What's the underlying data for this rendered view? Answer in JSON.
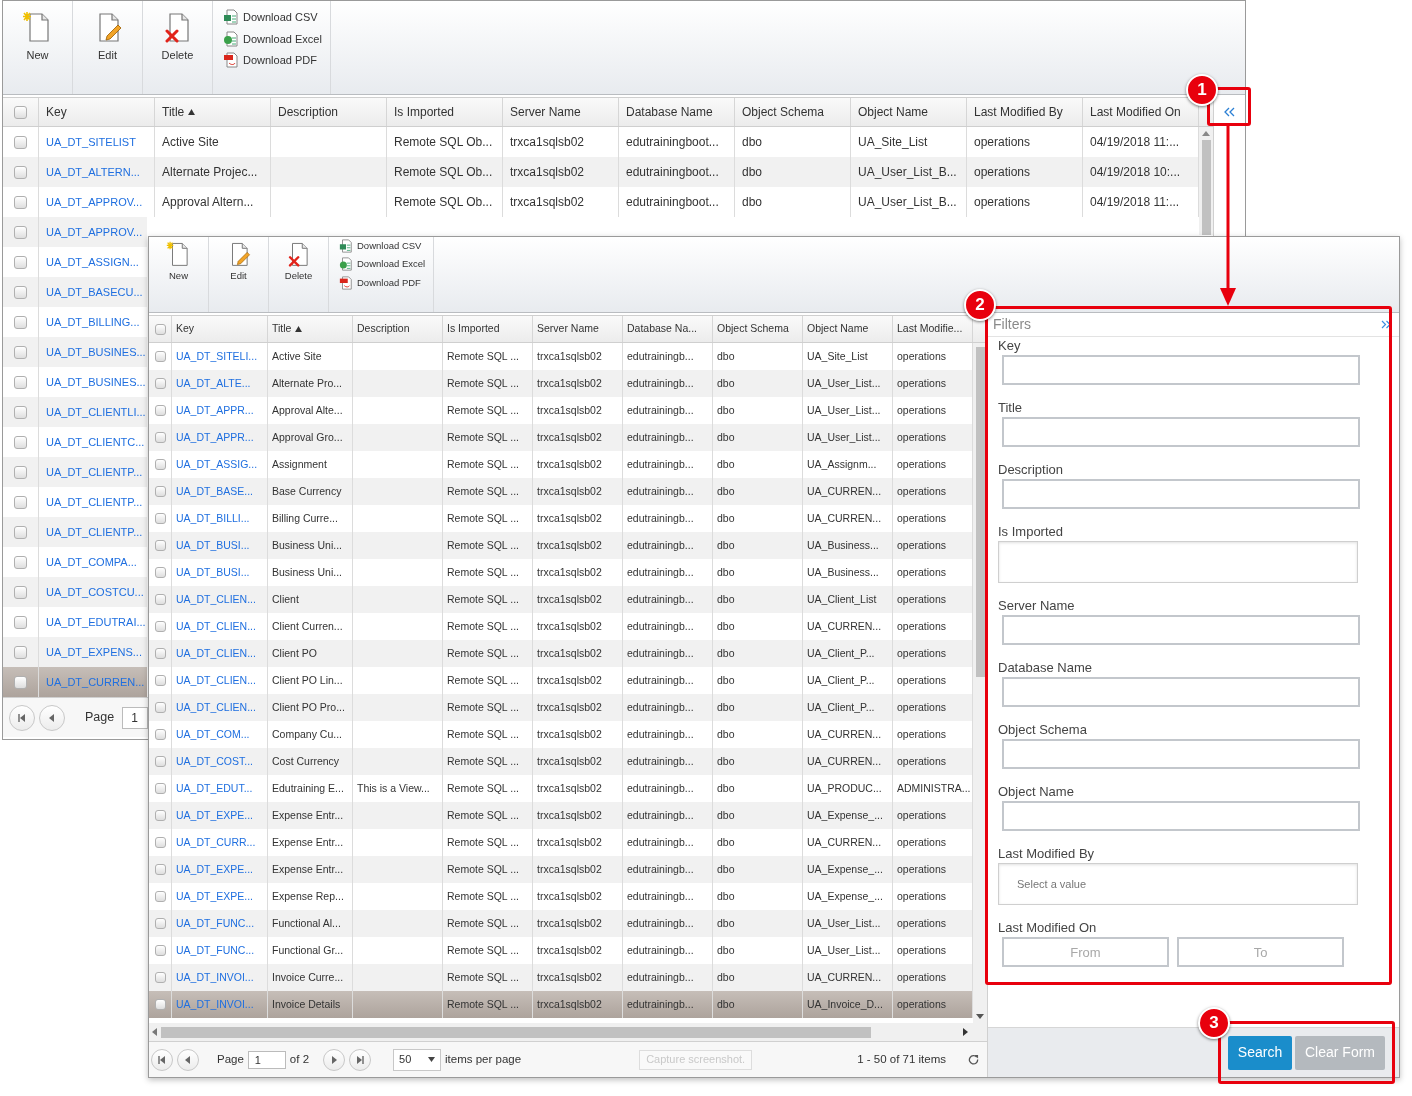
{
  "back_window": {
    "toolbar": [
      {
        "label": "New",
        "kind": "large"
      },
      {
        "label": "Edit",
        "kind": "large"
      },
      {
        "label": "Delete",
        "kind": "large"
      },
      {
        "label": "Download CSV",
        "kind": "small"
      },
      {
        "label": "Download Excel",
        "kind": "small"
      },
      {
        "label": "Download PDF",
        "kind": "small"
      }
    ],
    "select_all": {
      "checked": false
    },
    "columns": [
      {
        "label": "Key",
        "sorted_ascending": false
      },
      {
        "label": "Title",
        "sorted_ascending": true
      },
      {
        "label": "Description",
        "sorted_ascending": false
      },
      {
        "label": "Is Imported",
        "sorted_ascending": false
      },
      {
        "label": "Server Name",
        "sorted_ascending": false
      },
      {
        "label": "Database Name",
        "sorted_ascending": false
      },
      {
        "label": "Object Schema",
        "sorted_ascending": false
      },
      {
        "label": "Object Name",
        "sorted_ascending": false
      },
      {
        "label": "Last Modified By",
        "sorted_ascending": false
      },
      {
        "label": "Last Modified On",
        "sorted_ascending": false
      }
    ],
    "rows": [
      {
        "cells": [
          "UA_DT_SITELIST",
          "Active Site",
          null,
          "Remote SQL Ob...",
          "trxca1sqlsb02",
          "edutrainingboot...",
          "dbo",
          "UA_Site_List",
          "operations",
          "04/19/2018 11:..."
        ],
        "selected": false
      },
      {
        "cells": [
          "UA_DT_ALTERN...",
          "Alternate Projec...",
          null,
          "Remote SQL Ob...",
          "trxca1sqlsb02",
          "edutrainingboot...",
          "dbo",
          "UA_User_List_B...",
          "operations",
          "04/19/2018 10:..."
        ],
        "selected": false
      },
      {
        "cells": [
          "UA_DT_APPROV...",
          "Approval Altern...",
          null,
          "Remote SQL Ob...",
          "trxca1sqlsb02",
          "edutrainingboot...",
          "dbo",
          "UA_User_List_B...",
          "operations",
          "04/19/2018 11:..."
        ],
        "selected": false
      },
      {
        "cells": [
          "UA_DT_APPROV..."
        ],
        "selected": false
      },
      {
        "cells": [
          "UA_DT_ASSIGN..."
        ],
        "selected": false
      },
      {
        "cells": [
          "UA_DT_BASECU..."
        ],
        "selected": false
      },
      {
        "cells": [
          "UA_DT_BILLING..."
        ],
        "selected": false
      },
      {
        "cells": [
          "UA_DT_BUSINES..."
        ],
        "selected": false
      },
      {
        "cells": [
          "UA_DT_BUSINES..."
        ],
        "selected": false
      },
      {
        "cells": [
          "UA_DT_CLIENTLI..."
        ],
        "selected": false
      },
      {
        "cells": [
          "UA_DT_CLIENTC..."
        ],
        "selected": false
      },
      {
        "cells": [
          "UA_DT_CLIENTP..."
        ],
        "selected": false
      },
      {
        "cells": [
          "UA_DT_CLIENTP..."
        ],
        "selected": false
      },
      {
        "cells": [
          "UA_DT_CLIENTP..."
        ],
        "selected": false
      },
      {
        "cells": [
          "UA_DT_COMPA..."
        ],
        "selected": false
      },
      {
        "cells": [
          "UA_DT_COSTCU..."
        ],
        "selected": false
      },
      {
        "cells": [
          "UA_DT_EDUTRAI..."
        ],
        "selected": false
      },
      {
        "cells": [
          "UA_DT_EXPENS..."
        ],
        "selected": false
      },
      {
        "cells": [
          "UA_DT_CURREN..."
        ],
        "selected": true
      }
    ],
    "pager": {
      "page_label": "Page",
      "page": "1"
    }
  },
  "front_window": {
    "toolbar": [
      {
        "label": "New",
        "kind": "large"
      },
      {
        "label": "Edit",
        "kind": "large"
      },
      {
        "label": "Delete",
        "kind": "large"
      },
      {
        "label": "Download CSV",
        "kind": "small"
      },
      {
        "label": "Download Excel",
        "kind": "small"
      },
      {
        "label": "Download PDF",
        "kind": "small"
      }
    ],
    "select_all": {
      "checked": false
    },
    "columns": [
      {
        "label": "Key",
        "sorted_ascending": false
      },
      {
        "label": "Title",
        "sorted_ascending": true
      },
      {
        "label": "Description",
        "sorted_ascending": false
      },
      {
        "label": "Is Imported",
        "sorted_ascending": false
      },
      {
        "label": "Server Name",
        "sorted_ascending": false
      },
      {
        "label": "Database Na...",
        "sorted_ascending": false
      },
      {
        "label": "Object Schema",
        "sorted_ascending": false
      },
      {
        "label": "Object Name",
        "sorted_ascending": false
      },
      {
        "label": "Last Modifie...",
        "sorted_ascending": false
      }
    ],
    "rows": [
      {
        "cells": [
          "UA_DT_SITELI...",
          "Active Site",
          null,
          "Remote SQL ...",
          "trxca1sqlsb02",
          "edutrainingb...",
          "dbo",
          "UA_Site_List",
          "operations"
        ],
        "selected": false
      },
      {
        "cells": [
          "UA_DT_ALTE...",
          "Alternate Pro...",
          null,
          "Remote SQL ...",
          "trxca1sqlsb02",
          "edutrainingb...",
          "dbo",
          "UA_User_List...",
          "operations"
        ],
        "selected": false
      },
      {
        "cells": [
          "UA_DT_APPR...",
          "Approval Alte...",
          null,
          "Remote SQL ...",
          "trxca1sqlsb02",
          "edutrainingb...",
          "dbo",
          "UA_User_List...",
          "operations"
        ],
        "selected": false
      },
      {
        "cells": [
          "UA_DT_APPR...",
          "Approval Gro...",
          null,
          "Remote SQL ...",
          "trxca1sqlsb02",
          "edutrainingb...",
          "dbo",
          "UA_User_List...",
          "operations"
        ],
        "selected": false
      },
      {
        "cells": [
          "UA_DT_ASSIG...",
          "Assignment",
          null,
          "Remote SQL ...",
          "trxca1sqlsb02",
          "edutrainingb...",
          "dbo",
          "UA_Assignm...",
          "operations"
        ],
        "selected": false
      },
      {
        "cells": [
          "UA_DT_BASE...",
          "Base Currency",
          null,
          "Remote SQL ...",
          "trxca1sqlsb02",
          "edutrainingb...",
          "dbo",
          "UA_CURREN...",
          "operations"
        ],
        "selected": false
      },
      {
        "cells": [
          "UA_DT_BILLI...",
          "Billing Curre...",
          null,
          "Remote SQL ...",
          "trxca1sqlsb02",
          "edutrainingb...",
          "dbo",
          "UA_CURREN...",
          "operations"
        ],
        "selected": false
      },
      {
        "cells": [
          "UA_DT_BUSI...",
          "Business Uni...",
          null,
          "Remote SQL ...",
          "trxca1sqlsb02",
          "edutrainingb...",
          "dbo",
          "UA_Business...",
          "operations"
        ],
        "selected": false
      },
      {
        "cells": [
          "UA_DT_BUSI...",
          "Business Uni...",
          null,
          "Remote SQL ...",
          "trxca1sqlsb02",
          "edutrainingb...",
          "dbo",
          "UA_Business...",
          "operations"
        ],
        "selected": false
      },
      {
        "cells": [
          "UA_DT_CLIEN...",
          "Client",
          null,
          "Remote SQL ...",
          "trxca1sqlsb02",
          "edutrainingb...",
          "dbo",
          "UA_Client_List",
          "operations"
        ],
        "selected": false
      },
      {
        "cells": [
          "UA_DT_CLIEN...",
          "Client Curren...",
          null,
          "Remote SQL ...",
          "trxca1sqlsb02",
          "edutrainingb...",
          "dbo",
          "UA_CURREN...",
          "operations"
        ],
        "selected": false
      },
      {
        "cells": [
          "UA_DT_CLIEN...",
          "Client PO",
          null,
          "Remote SQL ...",
          "trxca1sqlsb02",
          "edutrainingb...",
          "dbo",
          "UA_Client_P...",
          "operations"
        ],
        "selected": false
      },
      {
        "cells": [
          "UA_DT_CLIEN...",
          "Client PO Lin...",
          null,
          "Remote SQL ...",
          "trxca1sqlsb02",
          "edutrainingb...",
          "dbo",
          "UA_Client_P...",
          "operations"
        ],
        "selected": false
      },
      {
        "cells": [
          "UA_DT_CLIEN...",
          "Client PO Pro...",
          null,
          "Remote SQL ...",
          "trxca1sqlsb02",
          "edutrainingb...",
          "dbo",
          "UA_Client_P...",
          "operations"
        ],
        "selected": false
      },
      {
        "cells": [
          "UA_DT_COM...",
          "Company Cu...",
          null,
          "Remote SQL ...",
          "trxca1sqlsb02",
          "edutrainingb...",
          "dbo",
          "UA_CURREN...",
          "operations"
        ],
        "selected": false
      },
      {
        "cells": [
          "UA_DT_COST...",
          "Cost Currency",
          null,
          "Remote SQL ...",
          "trxca1sqlsb02",
          "edutrainingb...",
          "dbo",
          "UA_CURREN...",
          "operations"
        ],
        "selected": false
      },
      {
        "cells": [
          "UA_DT_EDUT...",
          "Edutraining E...",
          "This is a View...",
          "Remote SQL ...",
          "trxca1sqlsb02",
          "edutrainingb...",
          "dbo",
          "UA_PRODUC...",
          "ADMINISTRA..."
        ],
        "selected": false
      },
      {
        "cells": [
          "UA_DT_EXPE...",
          "Expense Entr...",
          null,
          "Remote SQL ...",
          "trxca1sqlsb02",
          "edutrainingb...",
          "dbo",
          "UA_Expense_...",
          "operations"
        ],
        "selected": false
      },
      {
        "cells": [
          "UA_DT_CURR...",
          "Expense Entr...",
          null,
          "Remote SQL ...",
          "trxca1sqlsb02",
          "edutrainingb...",
          "dbo",
          "UA_CURREN...",
          "operations"
        ],
        "selected": false
      },
      {
        "cells": [
          "UA_DT_EXPE...",
          "Expense Entr...",
          null,
          "Remote SQL ...",
          "trxca1sqlsb02",
          "edutrainingb...",
          "dbo",
          "UA_Expense_...",
          "operations"
        ],
        "selected": false
      },
      {
        "cells": [
          "UA_DT_EXPE...",
          "Expense Rep...",
          null,
          "Remote SQL ...",
          "trxca1sqlsb02",
          "edutrainingb...",
          "dbo",
          "UA_Expense_...",
          "operations"
        ],
        "selected": false
      },
      {
        "cells": [
          "UA_DT_FUNC...",
          "Functional Al...",
          null,
          "Remote SQL ...",
          "trxca1sqlsb02",
          "edutrainingb...",
          "dbo",
          "UA_User_List...",
          "operations"
        ],
        "selected": false
      },
      {
        "cells": [
          "UA_DT_FUNC...",
          "Functional Gr...",
          null,
          "Remote SQL ...",
          "trxca1sqlsb02",
          "edutrainingb...",
          "dbo",
          "UA_User_List...",
          "operations"
        ],
        "selected": false
      },
      {
        "cells": [
          "UA_DT_INVOI...",
          "Invoice Curre...",
          null,
          "Remote SQL ...",
          "trxca1sqlsb02",
          "edutrainingb...",
          "dbo",
          "UA_CURREN...",
          "operations"
        ],
        "selected": false
      },
      {
        "cells": [
          "UA_DT_INVOI...",
          "Invoice Details",
          null,
          "Remote SQL ...",
          "trxca1sqlsb02",
          "edutrainingb...",
          "dbo",
          "UA_Invoice_D...",
          "operations"
        ],
        "selected": true
      }
    ],
    "pager": {
      "page_label": "Page",
      "page": "1",
      "of": "of 2",
      "page_size": "50",
      "per_page_label": "items per page",
      "capture_hint": "Capture screenshot.",
      "summary": "1 - 50 of 71 items"
    }
  },
  "filters": {
    "title": "Filters",
    "fields": [
      {
        "label": "Key",
        "kind": "text"
      },
      {
        "label": "Title",
        "kind": "text"
      },
      {
        "label": "Description",
        "kind": "text"
      },
      {
        "label": "Is Imported",
        "kind": "select"
      },
      {
        "label": "Server Name",
        "kind": "text"
      },
      {
        "label": "Database Name",
        "kind": "text"
      },
      {
        "label": "Object Schema",
        "kind": "text"
      },
      {
        "label": "Object Name",
        "kind": "text"
      },
      {
        "label": "Last Modified By",
        "kind": "select",
        "placeholder": "Select a value"
      },
      {
        "label": "Last Modified On",
        "kind": "range",
        "from_placeholder": "From",
        "to_placeholder": "To"
      }
    ],
    "buttons": [
      {
        "label": "Search",
        "disabled": false
      },
      {
        "label": "Clear Form",
        "disabled": true
      }
    ]
  },
  "annotations": [
    {
      "number": "1"
    },
    {
      "number": "2"
    },
    {
      "number": "3"
    }
  ]
}
